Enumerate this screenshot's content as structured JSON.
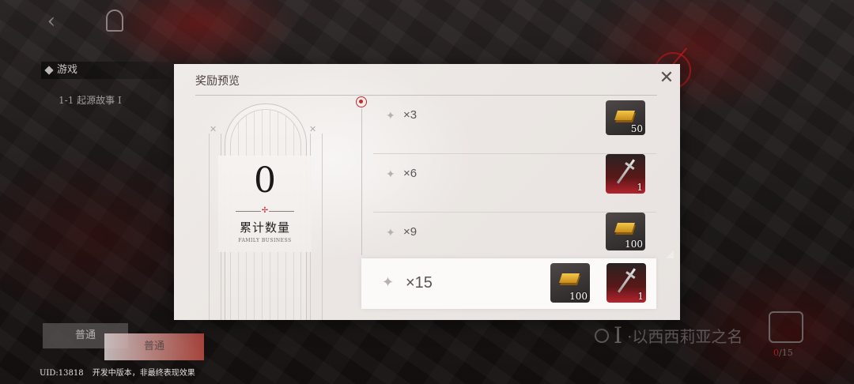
{
  "modal": {
    "title": "奖励预览",
    "close_symbol": "✕"
  },
  "counter": {
    "value": "0",
    "label": "累计数量",
    "sublabel": "FAMILY BUSINESS"
  },
  "rewards": [
    {
      "multiplier": "×3",
      "items": [
        {
          "type": "gold-bar-icon",
          "qty": "50"
        }
      ]
    },
    {
      "multiplier": "×6",
      "items": [
        {
          "type": "dagger-icon",
          "qty": "1"
        }
      ]
    },
    {
      "multiplier": "×9",
      "items": [
        {
          "type": "gold-bar-icon",
          "qty": "100"
        }
      ]
    },
    {
      "multiplier": "×15",
      "highlighted": true,
      "items": [
        {
          "type": "gold-bar-icon",
          "qty": "100"
        },
        {
          "type": "dagger-icon",
          "qty": "1"
        }
      ]
    }
  ],
  "background": {
    "side_title": "游戏",
    "stage": "1-1 起源故事 I",
    "btn_left": "普通",
    "btn_right": "普通",
    "uid": "UID:13818",
    "notice": "开发中版本，非最终表现效果",
    "bottom_roman": "I",
    "bottom_title": "·以西西莉亚之名",
    "crest_current": "0",
    "crest_total": "/15"
  },
  "colors": {
    "accent_red": "#c42a2a",
    "modal_bg": "#ebe6e3",
    "gold": "#f2c84a"
  }
}
